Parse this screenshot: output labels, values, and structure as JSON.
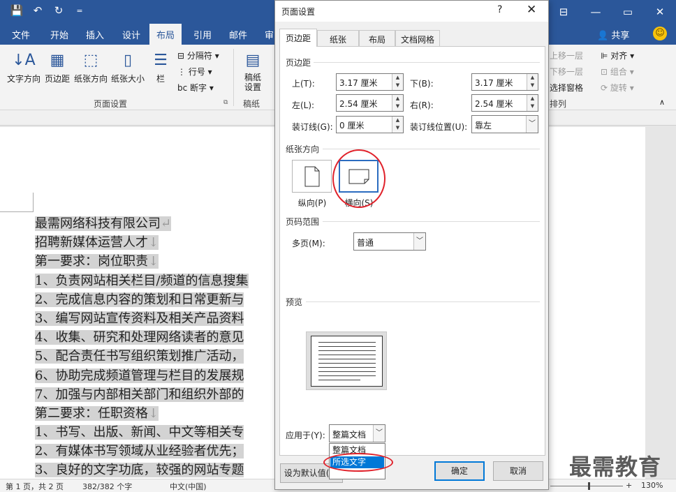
{
  "qat": {
    "save_icon": "💾",
    "undo_icon": "↶",
    "redo_icon": "↻",
    "more_icon": "="
  },
  "window": {
    "min_icon": "—",
    "restore_icon": "▭",
    "close_icon": "✕",
    "ribbon_icon": "⊟"
  },
  "tabs": {
    "file": "文件",
    "home": "开始",
    "insert": "插入",
    "design": "设计",
    "layout": "布局",
    "references": "引用",
    "mailings": "邮件",
    "review": "审",
    "share": "共享"
  },
  "ribbon": {
    "text_direction": "文字方向",
    "margins": "页边距",
    "orientation": "纸张方向",
    "size": "纸张大小",
    "columns": "栏",
    "breaks": "分隔符",
    "line_numbers": "行号",
    "hyphenation": "断字",
    "page_setup_group": "页面设置",
    "draft": "稿纸\n设置",
    "draft_group": "稿纸",
    "bring_forward": "上移一层",
    "send_backward": "下移一层",
    "selection_pane": "选择窗格",
    "align": "对齐",
    "group": "组合",
    "rotate": "旋转",
    "arrange_group": "排列"
  },
  "document": {
    "lines": [
      "最需网络科技有限公司",
      "招聘新媒体运营人才",
      "第一要求：岗位职责",
      "1、负责网站相关栏目/频道的信息搜集",
      "2、完成信息内容的策划和日常更新与",
      "3、编写网站宣传资料及相关产品资料",
      "4、收集、研究和处理网络读者的意见",
      "5、配合责任书写组织策划推广活动，",
      "6、协助完成频道管理与栏目的发展规",
      "7、加强与内部相关部门和组织外部的",
      "第二要求：任职资格",
      "1、书写、出版、新闻、中文等相关专",
      "2、有媒体书写领域从业经验者优先；",
      "3、良好的文字功底，较强的网站专题"
    ],
    "line_marks": [
      "↵",
      "↓",
      "↓",
      "",
      "",
      "",
      "",
      "",
      "",
      "",
      "↓",
      "",
      "",
      ""
    ]
  },
  "dialog": {
    "title": "页面设置",
    "help": "?",
    "close": "✕",
    "tabs": [
      "页边距",
      "纸张",
      "布局",
      "文档网格"
    ],
    "margins_section": "页边距",
    "top_label": "上(T):",
    "top_value": "3.17 厘米",
    "bottom_label": "下(B):",
    "bottom_value": "3.17 厘米",
    "left_label": "左(L):",
    "left_value": "2.54 厘米",
    "right_label": "右(R):",
    "right_value": "2.54 厘米",
    "gutter_label": "装订线(G):",
    "gutter_value": "0 厘米",
    "gutter_pos_label": "装订线位置(U):",
    "gutter_pos_value": "靠左",
    "orientation_section": "纸张方向",
    "portrait": "纵向(P)",
    "landscape": "横向(S)",
    "pages_section": "页码范围",
    "multiple_label": "多页(M):",
    "multiple_value": "普通",
    "preview_section": "预览",
    "apply_label": "应用于(Y):",
    "apply_value": "整篇文档",
    "apply_options": [
      "整篇文档",
      "所选文字"
    ],
    "set_default": "设为默认值(D)",
    "ok": "确定",
    "cancel": "取消"
  },
  "status": {
    "page": "第 1 页，共 2 页",
    "words": "382/382 个字",
    "lang": "中文(中国)",
    "minus": "−",
    "plus": "+",
    "zoom": "130%"
  },
  "watermark": "最需教育"
}
